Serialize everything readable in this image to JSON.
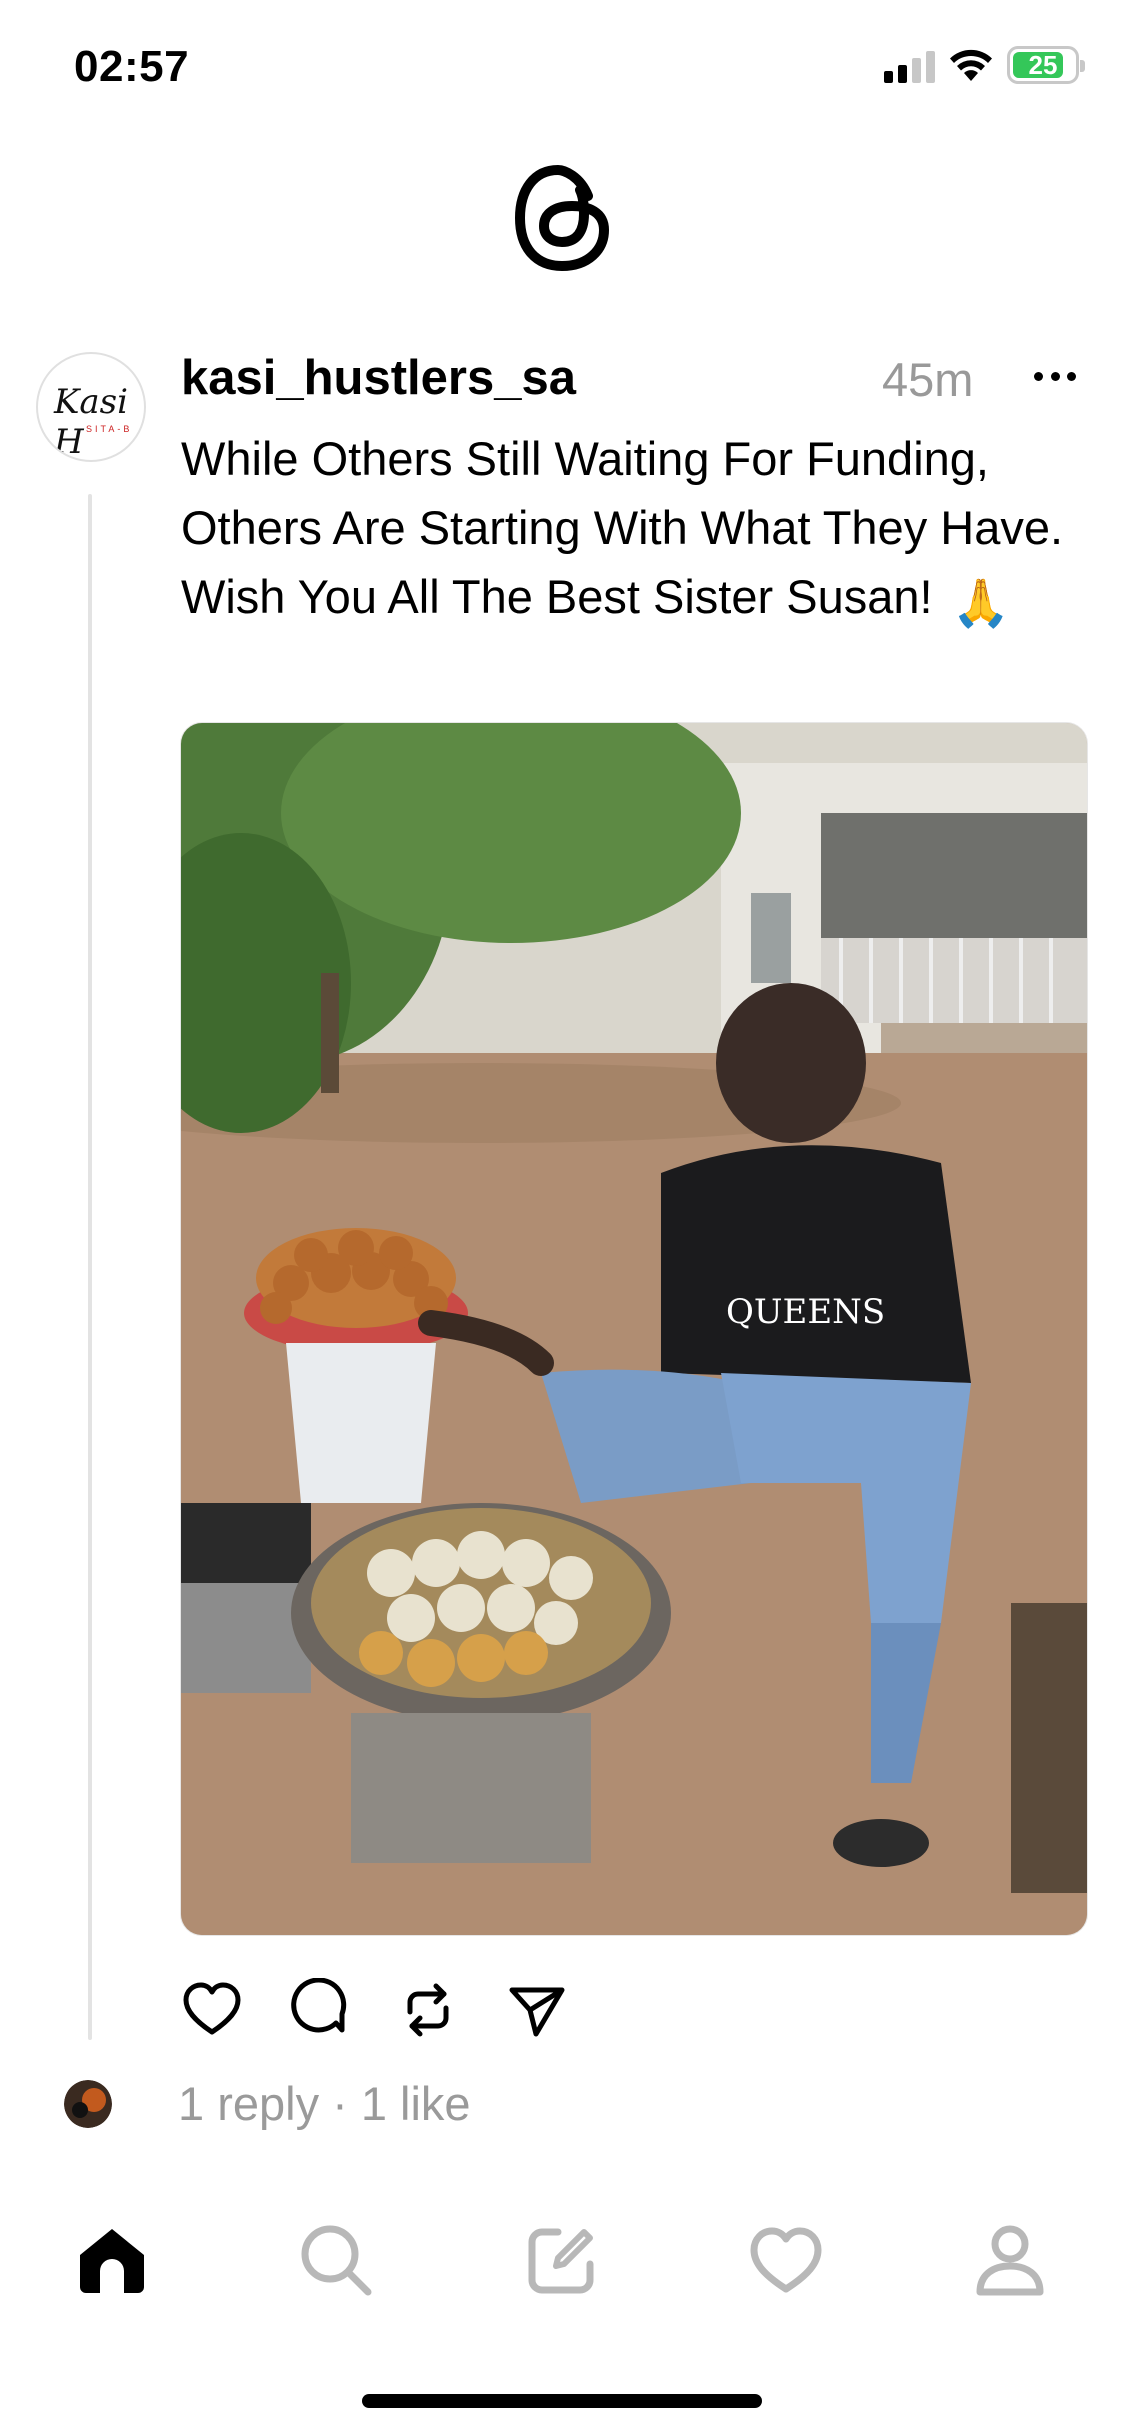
{
  "status_bar": {
    "time": "02:57",
    "battery": "25"
  },
  "app": {
    "logo_icon": "threads-logo-icon"
  },
  "post": {
    "username": "kasi_hustlers_sa",
    "timestamp": "45m",
    "avatar_text": "Kasi H",
    "avatar_subtext": "SITA-B",
    "text": "While Others Still Waiting For Funding, Others Are Starting With What They Have. Wish You All The Best Sister Susan!",
    "emoji": "🙏",
    "stats": "1 reply · 1 like"
  },
  "actions": [
    {
      "name": "like-icon"
    },
    {
      "name": "comment-icon"
    },
    {
      "name": "repost-icon"
    },
    {
      "name": "share-icon"
    }
  ],
  "tabs": [
    {
      "name": "home-icon",
      "active": true
    },
    {
      "name": "search-icon",
      "active": false
    },
    {
      "name": "compose-icon",
      "active": false
    },
    {
      "name": "activity-heart-icon",
      "active": false
    },
    {
      "name": "profile-icon",
      "active": false
    }
  ],
  "colors": {
    "accent_text": "#000000",
    "muted_text": "#999999",
    "inactive_icon": "#b8b8b8",
    "battery_green": "#34c759"
  }
}
